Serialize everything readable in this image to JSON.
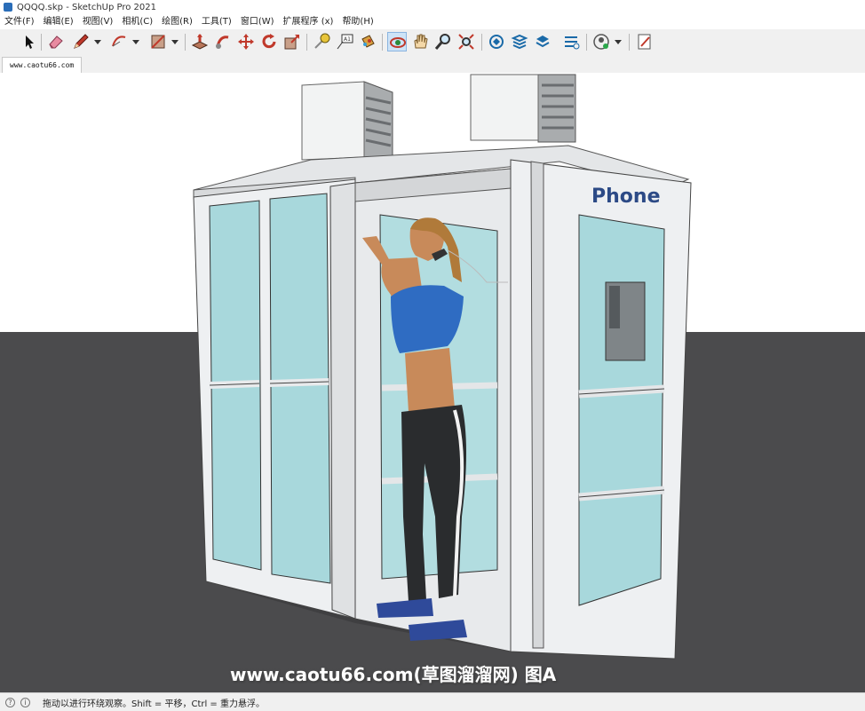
{
  "window": {
    "title": "QQQQ.skp - SketchUp Pro 2021"
  },
  "menu": [
    "文件(F)",
    "编辑(E)",
    "视图(V)",
    "相机(C)",
    "绘图(R)",
    "工具(T)",
    "窗口(W)",
    "扩展程序 (x)",
    "帮助(H)"
  ],
  "toolbar": {
    "buttons": [
      {
        "icon": "select-arrow-icon"
      },
      {
        "icon": "eraser-icon"
      },
      {
        "icon": "pencil-line-icon"
      },
      {
        "icon": "arc-icon"
      },
      {
        "icon": "rectangle-icon"
      },
      {
        "icon": "push-pull-icon"
      },
      {
        "icon": "follow-me-icon"
      },
      {
        "icon": "move-icon"
      },
      {
        "icon": "rotate-icon"
      },
      {
        "icon": "scale-icon"
      },
      {
        "icon": "tape-measure-icon"
      },
      {
        "icon": "text-icon"
      },
      {
        "icon": "paint-bucket-icon"
      },
      {
        "icon": "orbit-icon",
        "active": true
      },
      {
        "icon": "pan-icon"
      },
      {
        "icon": "zoom-icon"
      },
      {
        "icon": "zoom-extents-icon"
      },
      {
        "icon": "warehouse-icon"
      },
      {
        "icon": "extension-warehouse-icon"
      },
      {
        "icon": "layout-icon"
      },
      {
        "icon": "extension-manager-icon"
      },
      {
        "icon": "account-icon"
      },
      {
        "icon": "send-to-layout-icon"
      }
    ]
  },
  "scene_tab": {
    "label": "www.caotu66.com"
  },
  "viewport": {
    "sign_text": "Phone",
    "colors": {
      "sky": "#ffffff",
      "ground": "#4b4b4d",
      "frame": "#eef0f2",
      "glass": "#a8d8dc"
    }
  },
  "watermark": {
    "text": "www.caotu66.com(草图溜溜网) 图A"
  },
  "status": {
    "text": "拖动以进行环绕观察。Shift = 平移，Ctrl = 重力悬浮。"
  }
}
